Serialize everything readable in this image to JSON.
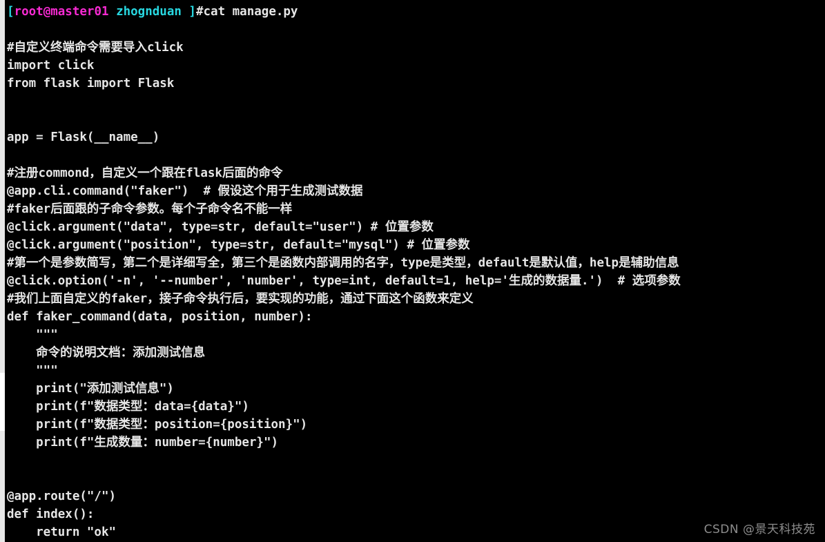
{
  "window": {
    "title": "Terminal",
    "background_color": "#000000",
    "foreground_color": "#e6e6e6"
  },
  "scrollbar": {
    "name": "vertical-scrollbar",
    "track_color": "#e8e8e8",
    "thumb_color": "#ffffff"
  },
  "prompt": {
    "open_bracket": "[",
    "user_host": "root@master01",
    "space": " ",
    "directory": "zhognduan",
    "close_bracket": " ]",
    "command": "#cat manage.py",
    "colors": {
      "bracket": "#28d7e0",
      "user_host": "#f72ad2",
      "directory": "#28d7e0",
      "command": "#e6e6e6"
    }
  },
  "file": {
    "name": "manage.py",
    "lines": [
      "",
      "#自定义终端命令需要导入click",
      "import click",
      "from flask import Flask",
      "",
      "",
      "app = Flask(__name__)",
      "",
      "#注册commond，自定义一个跟在flask后面的命令",
      "@app.cli.command(\"faker\")  # 假设这个用于生成测试数据",
      "#faker后面跟的子命令参数。每个子命令名不能一样",
      "@click.argument(\"data\", type=str, default=\"user\") # 位置参数",
      "@click.argument(\"position\", type=str, default=\"mysql\") # 位置参数",
      "#第一个是参数简写，第二个是详细写全，第三个是函数内部调用的名字，type是类型，default是默认值，help是辅助信息",
      "@click.option('-n', '--number', 'number', type=int, default=1, help='生成的数据量.')  # 选项参数",
      "#我们上面自定义的faker，接子命令执行后，要实现的功能，通过下面这个函数来定义",
      "def faker_command(data, position, number):",
      "    \"\"\"",
      "    命令的说明文档：添加测试信息",
      "    \"\"\"",
      "    print(\"添加测试信息\")",
      "    print(f\"数据类型：data={data}\")",
      "    print(f\"数据类型：position={position}\")",
      "    print(f\"生成数量：number={number}\")",
      "",
      "",
      "@app.route(\"/\")",
      "def index():",
      "    return \"ok\""
    ]
  },
  "watermark": {
    "text": "CSDN @景天科技苑",
    "color": "#8d8d8d"
  }
}
